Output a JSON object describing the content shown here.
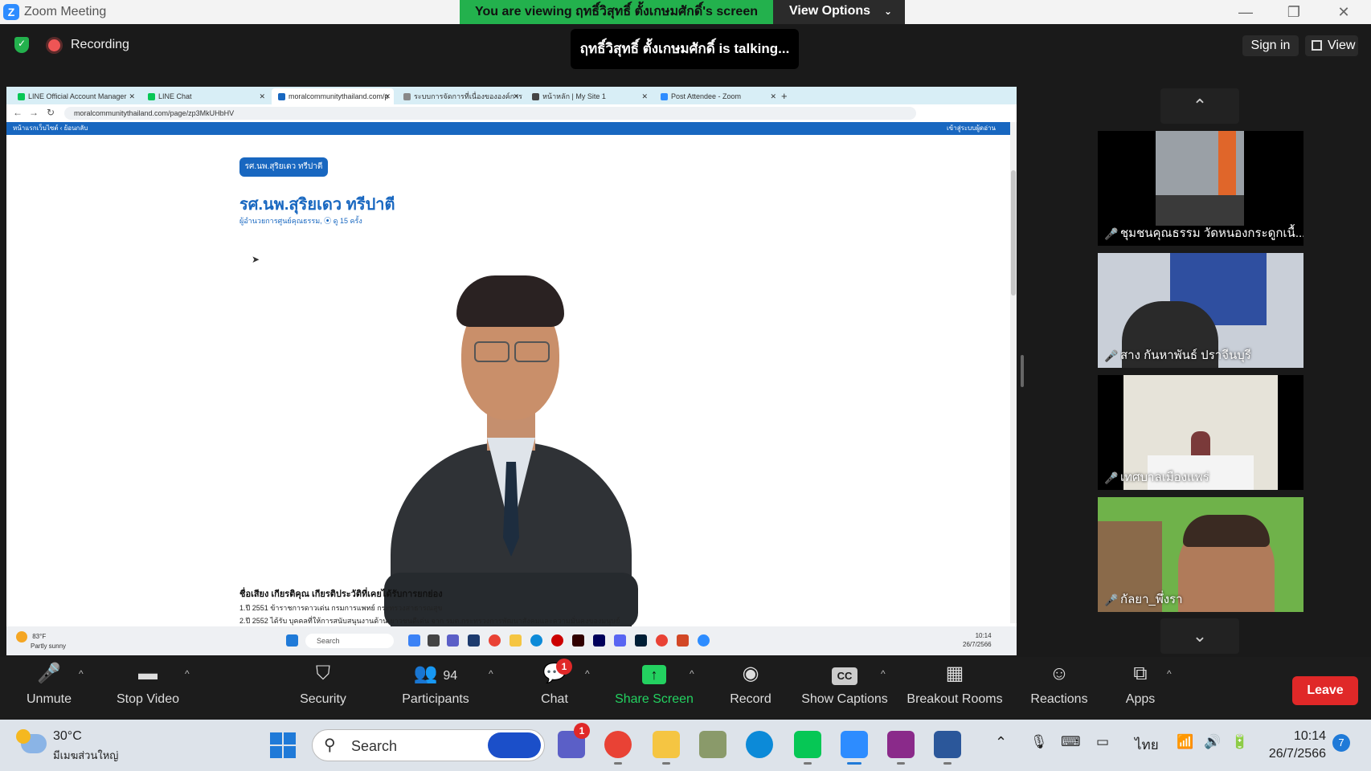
{
  "window": {
    "app_title": "Zoom Meeting",
    "viewing_banner": "You are viewing ฤทธิ์วิสุทธิ์ ตั้งเกษมศักดิ์'s screen",
    "view_options": "View Options",
    "talking": "ฤทธิ์วิสุทธิ์ ตั้งเกษมศักดิ์ is talking...",
    "recording": "Recording",
    "sign_in": "Sign in",
    "view": "View",
    "minimize": "—",
    "restore": "❐",
    "close": "✕"
  },
  "shared_screen": {
    "tabs": [
      {
        "label": "LINE Official Account Manager",
        "color": "#06c755"
      },
      {
        "label": "LINE Chat",
        "color": "#06c755"
      },
      {
        "label": "moralcommunitythailand.com/p",
        "color": "#1867c0"
      },
      {
        "label": "ระบบการจัดการที่เนื่องขององค์การ",
        "color": "#888888"
      },
      {
        "label": "หน้าหลัก | My Site 1",
        "color": "#444444"
      },
      {
        "label": "Post Attendee - Zoom",
        "color": "#2d8cff"
      }
    ],
    "new_tab": "+",
    "url": "moralcommunitythailand.com/page/zp3MkUHbHV",
    "site_nav": "หน้าแรกเว็บไซต์ ‹ ย้อนกลับ",
    "site_login": "เข้าสู่ระบบผู้ดอ่าน",
    "pill": "รศ.นพ.สุริยเดว ทรีปาตี",
    "title": "รศ.นพ.สุริยเดว ทรีปาตี",
    "subtitle": "ผู้อำนวยการศูนย์คุณธรรม, ⦿ ดู 15 ครั้ง",
    "bio_heading": "ชื่อเสียง เกียรติคุณ เกียรติประวัติที่เคยได้รับการยกย่อง",
    "bio_lines": [
      "1.ปี 2551 ข้าราชการดาวเด่น กรมการแพทย์ กระทรวงสาธารณสุข",
      "2.ปี 2552 ได้รับ บุคคลที่ให้การสนับสนุนงานด้านเยาวชนดีเด่น จาก รมต.กระทรวงการพัฒนาสังคมและความมั่นคงของมนุษย์"
    ],
    "taskbar": {
      "weather_temp": "83°F",
      "weather_cond": "Partly sunny",
      "search": "Search",
      "time": "10:14",
      "date": "26/7/2566"
    }
  },
  "gallery": {
    "up": "⌃",
    "down": "⌄",
    "participants": [
      {
        "name": "ชุมชนคุณธรรม วัดหนองกระดูกเนื้..."
      },
      {
        "name": "สาง กันหาพันธ์ ปราจีนบุรี"
      },
      {
        "name": "เทศบาลเมืองแพร่"
      },
      {
        "name": "กัลยา_พึ่งรา"
      }
    ]
  },
  "toolbar": {
    "unmute": "Unmute",
    "stop_video": "Stop Video",
    "security": "Security",
    "participants": "Participants",
    "participants_count": "94",
    "chat": "Chat",
    "chat_badge": "1",
    "share_screen": "Share Screen",
    "record": "Record",
    "show_captions": "Show Captions",
    "captions_icon": "CC",
    "breakout_rooms": "Breakout Rooms",
    "reactions": "Reactions",
    "apps": "Apps",
    "leave": "Leave",
    "share_color": "#23d160"
  },
  "taskbar": {
    "temp": "30°C",
    "condition": "มีเมฆส่วนใหญ่",
    "search": "Search",
    "teams_badge": "1",
    "lang": "ไทย",
    "time": "10:14",
    "date": "26/7/2566",
    "notifications": "7"
  }
}
